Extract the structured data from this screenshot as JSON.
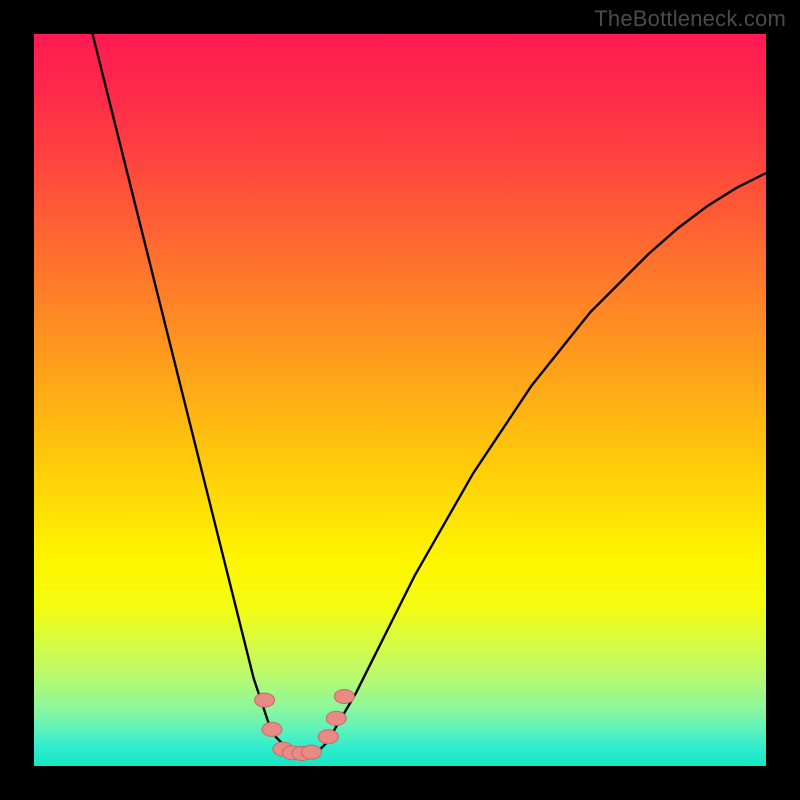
{
  "watermark": "TheBottleneck.com",
  "colors": {
    "frame_bg": "#000000",
    "gradient_top": "#ff1a52",
    "gradient_bottom": "#14e7c5",
    "curve": "#000000",
    "dot_fill": "#e88a85",
    "dot_stroke": "#c76964"
  },
  "chart_data": {
    "type": "line",
    "title": "",
    "xlabel": "",
    "ylabel": "",
    "xlim": [
      0,
      100
    ],
    "ylim": [
      0,
      100
    ],
    "grid": false,
    "legend": false,
    "note": "V-shaped bottleneck curve; background gradient encodes severity (red=high, green=low). Values estimated from pixel positions; no axis ticks are drawn.",
    "series": [
      {
        "name": "bottleneck-curve",
        "x": [
          8,
          10,
          12,
          14,
          16,
          18,
          20,
          22,
          24,
          26,
          28,
          30,
          32,
          33,
          34,
          35,
          36,
          37,
          38,
          39,
          40,
          44,
          48,
          52,
          56,
          60,
          64,
          68,
          72,
          76,
          80,
          84,
          88,
          92,
          96,
          100
        ],
        "y": [
          100,
          92,
          84,
          76,
          68,
          60,
          52,
          44,
          36,
          28,
          20,
          12,
          6,
          4,
          3,
          2.2,
          1.8,
          1.6,
          1.8,
          2.2,
          3.2,
          10,
          18,
          26,
          33,
          40,
          46,
          52,
          57,
          62,
          66,
          70,
          73.5,
          76.5,
          79,
          81
        ]
      }
    ],
    "markers": [
      {
        "name": "left-upper",
        "x": 31.5,
        "y": 9
      },
      {
        "name": "left-lower",
        "x": 32.5,
        "y": 5
      },
      {
        "name": "bottom-1",
        "x": 34.0,
        "y": 2.3
      },
      {
        "name": "bottom-2",
        "x": 35.3,
        "y": 1.8
      },
      {
        "name": "bottom-3",
        "x": 36.6,
        "y": 1.7
      },
      {
        "name": "bottom-4",
        "x": 37.9,
        "y": 1.9
      },
      {
        "name": "right-lower",
        "x": 40.2,
        "y": 4
      },
      {
        "name": "right-mid",
        "x": 41.3,
        "y": 6.5
      },
      {
        "name": "right-upper",
        "x": 42.4,
        "y": 9.5
      }
    ]
  }
}
